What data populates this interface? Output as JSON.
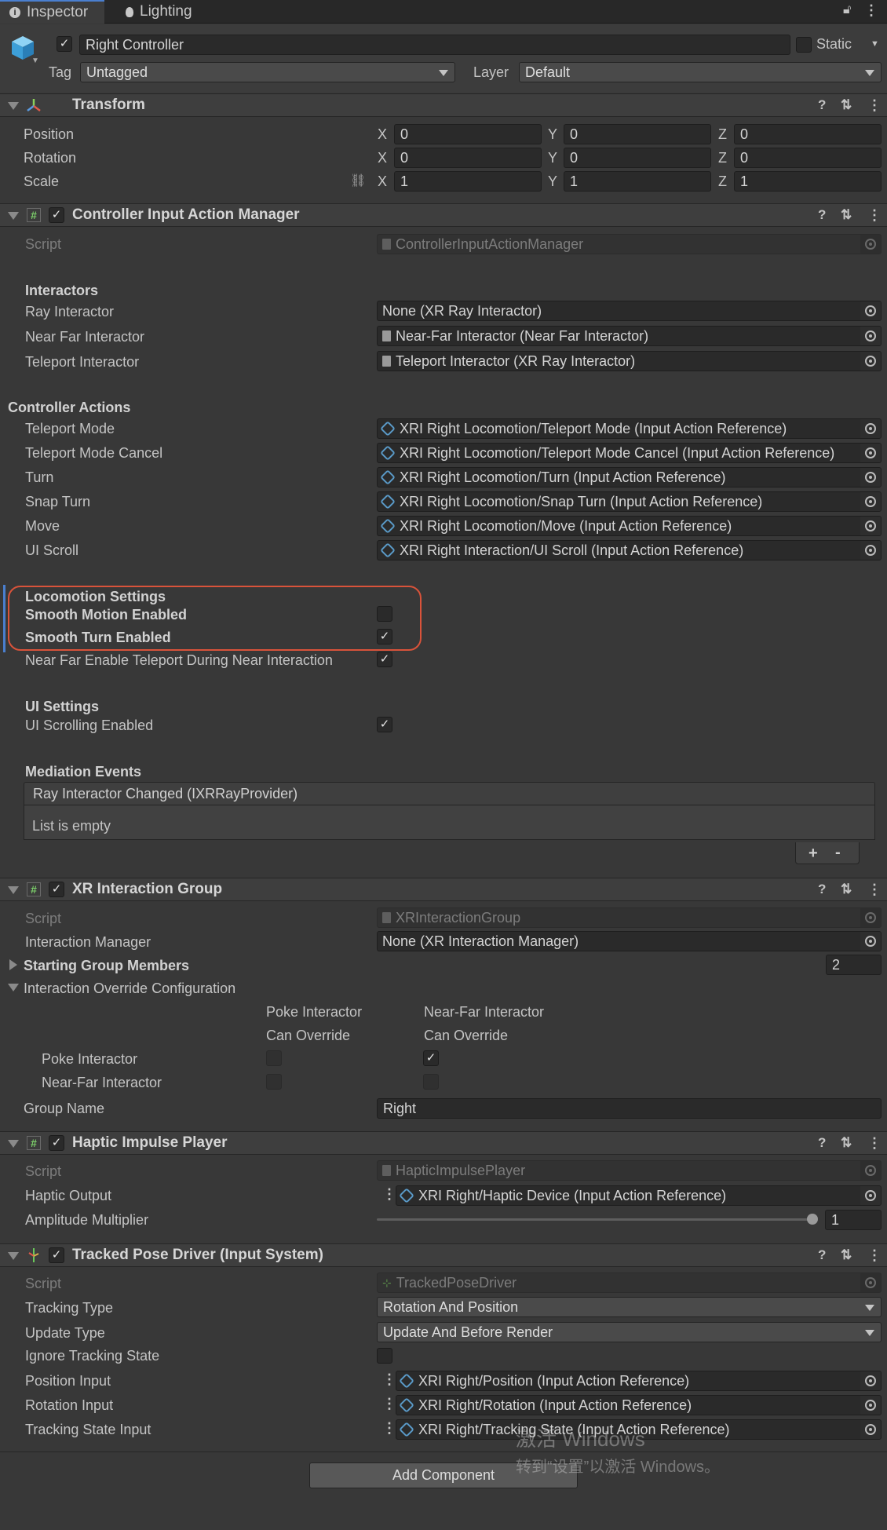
{
  "tabs": [
    {
      "label": "Inspector"
    },
    {
      "label": "Lighting"
    }
  ],
  "object": {
    "name": "Right Controller",
    "static_label": "Static",
    "tag_label": "Tag",
    "tag_value": "Untagged",
    "layer_label": "Layer",
    "layer_value": "Default"
  },
  "transform": {
    "title": "Transform",
    "rows": [
      {
        "label": "Position",
        "x": "0",
        "y": "0",
        "z": "0"
      },
      {
        "label": "Rotation",
        "x": "0",
        "y": "0",
        "z": "0"
      },
      {
        "label": "Scale",
        "x": "1",
        "y": "1",
        "z": "1"
      }
    ]
  },
  "xyz": {
    "x": "X",
    "y": "Y",
    "z": "Z"
  },
  "ciam": {
    "title": "Controller Input Action Manager",
    "script_label": "Script",
    "script_value": "ControllerInputActionManager",
    "interactors_header": "Interactors",
    "interactors": [
      {
        "label": "Ray Interactor",
        "value": "None (XR Ray Interactor)"
      },
      {
        "label": "Near Far Interactor",
        "value": "Near-Far Interactor (Near Far Interactor)"
      },
      {
        "label": "Teleport Interactor",
        "value": "Teleport Interactor (XR Ray Interactor)"
      }
    ],
    "actions_header": "Controller Actions",
    "actions": [
      {
        "label": "Teleport Mode",
        "value": "XRI Right Locomotion/Teleport Mode (Input Action Reference)"
      },
      {
        "label": "Teleport Mode Cancel",
        "value": "XRI Right Locomotion/Teleport Mode Cancel (Input Action Reference)"
      },
      {
        "label": "Turn",
        "value": "XRI Right Locomotion/Turn (Input Action Reference)"
      },
      {
        "label": "Snap Turn",
        "value": "XRI Right Locomotion/Snap Turn (Input Action Reference)"
      },
      {
        "label": "Move",
        "value": "XRI Right Locomotion/Move (Input Action Reference)"
      },
      {
        "label": "UI Scroll",
        "value": "XRI Right Interaction/UI Scroll (Input Action Reference)"
      }
    ],
    "locomotion_header": "Locomotion Settings",
    "smooth_motion_label": "Smooth Motion Enabled",
    "smooth_motion_checked": false,
    "smooth_turn_label": "Smooth Turn Enabled",
    "smooth_turn_checked": true,
    "near_far_teleport_label": "Near Far Enable Teleport During Near Interaction",
    "near_far_teleport_checked": true,
    "ui_header": "UI Settings",
    "ui_scrolling_label": "UI Scrolling Enabled",
    "ui_scrolling_checked": true,
    "mediation_header": "Mediation Events",
    "event_title": "Ray Interactor Changed (IXRRayProvider)",
    "event_empty": "List is empty",
    "plus": "+",
    "minus": "-"
  },
  "xrig": {
    "title": "XR Interaction Group",
    "script_label": "Script",
    "script_value": "XRInteractionGroup",
    "manager_label": "Interaction Manager",
    "manager_value": "None (XR Interaction Manager)",
    "members_label": "Starting Group Members",
    "members_count": "2",
    "override_label": "Interaction Override Configuration",
    "col1_line1": "Poke Interactor",
    "col1_line2": "Can Override",
    "col2_line1": "Near-Far Interactor",
    "col2_line2": "Can Override",
    "row1_label": "Poke Interactor",
    "row2_label": "Near-Far Interactor",
    "group_name_label": "Group Name",
    "group_name_value": "Right"
  },
  "haptic": {
    "title": "Haptic Impulse Player",
    "script_label": "Script",
    "script_value": "HapticImpulsePlayer",
    "output_label": "Haptic Output",
    "output_value": "XRI Right/Haptic Device (Input Action Reference)",
    "amp_label": "Amplitude Multiplier",
    "amp_value": "1",
    "amp_fraction": 1.0
  },
  "tpd": {
    "title": "Tracked Pose Driver (Input System)",
    "script_label": "Script",
    "script_value": "TrackedPoseDriver",
    "tracking_type_label": "Tracking Type",
    "tracking_type_value": "Rotation And Position",
    "update_type_label": "Update Type",
    "update_type_value": "Update And Before Render",
    "ignore_label": "Ignore Tracking State",
    "ignore_checked": false,
    "inputs": [
      {
        "label": "Position Input",
        "value": "XRI Right/Position (Input Action Reference)"
      },
      {
        "label": "Rotation Input",
        "value": "XRI Right/Rotation (Input Action Reference)"
      },
      {
        "label": "Tracking State Input",
        "value": "XRI Right/Tracking State (Input Action Reference)"
      }
    ]
  },
  "add_component": "Add Component",
  "watermark": {
    "line1": "激活 Windows",
    "line2": "转到“设置”以激活 Windows。"
  },
  "colors": {
    "highlight": "#d9533a",
    "accent": "#4a7fcf"
  }
}
